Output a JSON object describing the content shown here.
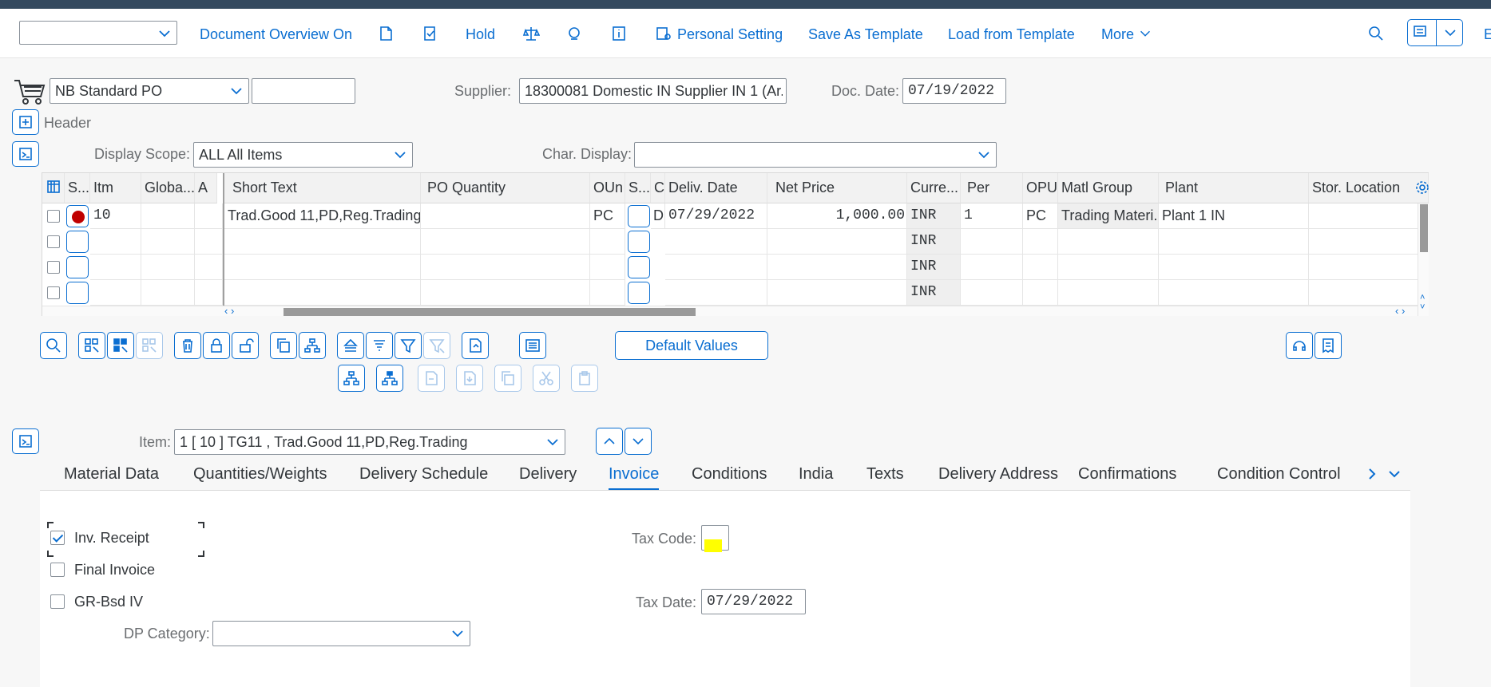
{
  "toolbar": {
    "document_overview": "Document Overview On",
    "hold": "Hold",
    "personal_setting": "Personal Setting",
    "save_as_template": "Save As Template",
    "load_from_template": "Load from Template",
    "more": "More",
    "edge_text": "E"
  },
  "header": {
    "doc_type": "NB Standard PO",
    "doc_number": "",
    "supplier_label": "Supplier:",
    "supplier_value": "18300081 Domestic IN Supplier IN 1 (Ar...",
    "doc_date_label": "Doc. Date:",
    "doc_date_value": "07/19/2022",
    "header_label": "Header",
    "display_scope_label": "Display Scope:",
    "display_scope_value": "ALL All Items",
    "char_display_label": "Char. Display:",
    "char_display_value": ""
  },
  "table": {
    "columns": [
      "S...",
      "Itm",
      "Globa...",
      "A",
      "Short Text",
      "PO Quantity",
      "OUn",
      "S...",
      "C",
      "Deliv. Date",
      "Net Price",
      "Curre...",
      "Per",
      "OPU",
      "Matl Group",
      "Plant",
      "Stor. Location"
    ],
    "rows": [
      {
        "itm": "10",
        "short_text": "Trad.Good 11,PD,Reg.Trading",
        "oun": "PC",
        "c": "D",
        "deliv_date": "07/29/2022",
        "net_price": "1,000.00",
        "currency": "INR",
        "per": "1",
        "opu": "PC",
        "matl_group": "Trading Materi...",
        "plant": "Plant 1 IN"
      },
      {
        "currency": "INR"
      },
      {
        "currency": "INR"
      },
      {
        "currency": "INR"
      }
    ]
  },
  "buttons": {
    "default_values": "Default Values"
  },
  "item": {
    "label": "Item:",
    "value": "1 [ 10 ] TG11 , Trad.Good 11,PD,Reg.Trading"
  },
  "tabs": [
    "Material Data",
    "Quantities/Weights",
    "Delivery Schedule",
    "Delivery",
    "Invoice",
    "Conditions",
    "India",
    "Texts",
    "Delivery Address",
    "Confirmations",
    "Condition Control"
  ],
  "invoice": {
    "inv_receipt": "Inv. Receipt",
    "final_invoice": "Final Invoice",
    "gr_bsd_iv": "GR-Bsd IV",
    "dp_category_label": "DP Category:",
    "dp_category_value": "",
    "tax_code_label": "Tax Code:",
    "tax_code_value": "",
    "tax_date_label": "Tax Date:",
    "tax_date_value": "07/29/2022"
  },
  "colors": {
    "accent": "#0a6ed1",
    "shell": "#354a5f",
    "status_red": "#c00000",
    "highlight": "#ffff00"
  }
}
